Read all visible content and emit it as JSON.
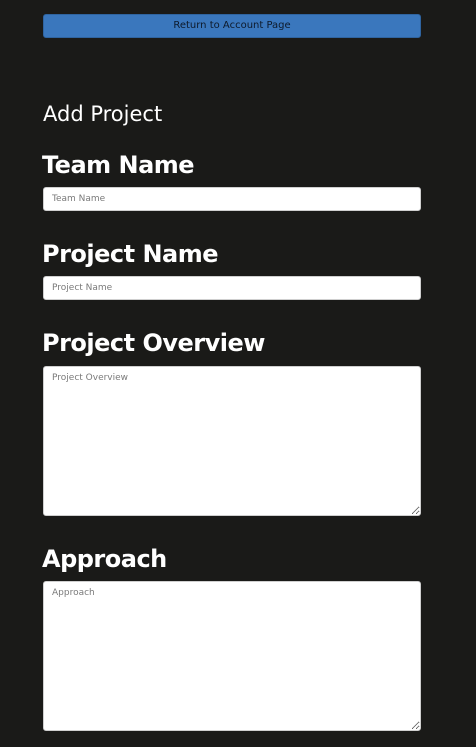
{
  "header": {
    "return_button_label": "Return to Account Page"
  },
  "form": {
    "title": "Add Project",
    "team_name": {
      "label": "Team Name",
      "placeholder": "Team Name",
      "value": ""
    },
    "project_name": {
      "label": "Project Name",
      "placeholder": "Project Name",
      "value": ""
    },
    "project_overview": {
      "label": "Project Overview",
      "placeholder": "Project Overview",
      "value": ""
    },
    "approach": {
      "label": "Approach",
      "placeholder": "Approach",
      "value": ""
    }
  },
  "colors": {
    "background": "#1a1a18",
    "button": "#3a77bd",
    "text": "#ffffff"
  }
}
